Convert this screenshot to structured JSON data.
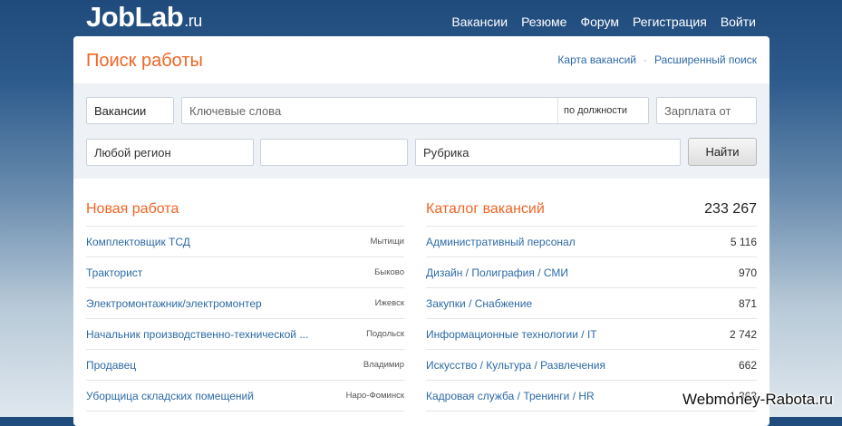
{
  "header": {
    "logo_main": "JobLab",
    "logo_tld": ".ru",
    "nav": [
      "Вакансии",
      "Резюме",
      "Форум",
      "Регистрация",
      "Войти"
    ]
  },
  "search": {
    "title": "Поиск работы",
    "links": [
      "Карта вакансий",
      "Расширенный поиск"
    ],
    "type_value": "Вакансии",
    "keywords_placeholder": "Ключевые слова",
    "keywords_mode": "по должности",
    "salary_placeholder": "Зарплата от",
    "region_value": "Любой регион",
    "extra_value": "",
    "rubric_value": "Рубрика",
    "submit_label": "Найти"
  },
  "new_jobs": {
    "title": "Новая работа",
    "items": [
      {
        "title": "Комплектовщик ТСД",
        "city": "Мытищи"
      },
      {
        "title": "Тракторист",
        "city": "Быково"
      },
      {
        "title": "Электромонтажник/электромонтер",
        "city": "Ижевск"
      },
      {
        "title": "Начальник производственно-технической ...",
        "city": "Подольск"
      },
      {
        "title": "Продавец",
        "city": "Владимир"
      },
      {
        "title": "Уборщица складских помещений",
        "city": "Наро-Фоминск"
      }
    ]
  },
  "catalog": {
    "title": "Каталог вакансий",
    "total": "233 267",
    "items": [
      {
        "title": "Административный персонал",
        "count": "5 116"
      },
      {
        "title": "Дизайн / Полиграфия / СМИ",
        "count": "970"
      },
      {
        "title": "Закупки / Снабжение",
        "count": "871"
      },
      {
        "title": "Информационные технологии / IT",
        "count": "2 742"
      },
      {
        "title": "Искусство / Культура / Развлечения",
        "count": "662"
      },
      {
        "title": "Кадровая служба / Тренинги / HR",
        "count": "1 363"
      }
    ]
  },
  "watermark": "Webmoney-Rabota.ru"
}
